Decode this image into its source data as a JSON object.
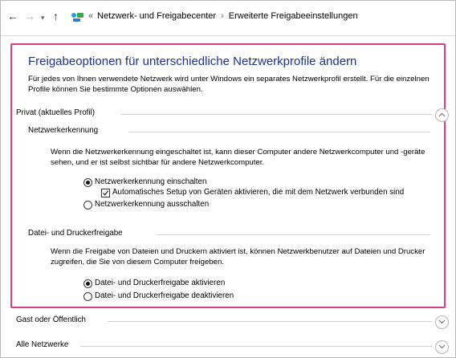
{
  "address_bar": {
    "back": "←",
    "forward": "→",
    "dropdown": "▾",
    "up": "↑",
    "overflow": "«",
    "crumbs": [
      "Netzwerk- und Freigabecenter",
      "Erweiterte Freigabeeinstellungen"
    ],
    "separator": "›"
  },
  "main": {
    "title": "Freigabeoptionen für unterschiedliche Netzwerkprofile ändern",
    "description": "Für jedes von Ihnen verwendete Netzwerk wird unter Windows ein separates Netzwerkprofil erstellt. Für die einzelnen Profile können Sie bestimmte Optionen auswählen."
  },
  "profiles": {
    "private": {
      "label": "Privat (aktuelles Profil)",
      "network_discovery": {
        "label": "Netzwerkerkennung",
        "text": "Wenn die Netzwerkerkennung eingeschaltet ist, kann dieser Computer andere Netzwerkcomputer und -geräte sehen, und er ist selbst sichtbar für andere Netzwerkcomputer.",
        "opt_on": "Netzwerkerkennung einschalten",
        "opt_auto": "Automatisches Setup von Geräten aktivieren, die mit dem Netzwerk verbunden sind",
        "opt_off": "Netzwerkerkennung ausschalten"
      },
      "file_printer": {
        "label": "Datei- und Druckerfreigabe",
        "text": "Wenn die Freigabe von Dateien und Druckern aktiviert ist, können Netzwerkbenutzer auf Dateien und Drucker zugreifen, die Sie von diesem Computer freigeben.",
        "opt_on": "Datei- und Druckerfreigabe aktivieren",
        "opt_off": "Datei- und Druckerfreigabe deaktivieren"
      }
    },
    "guest": {
      "label": "Gast oder Öffentlich"
    },
    "all": {
      "label": "Alle Netzwerke"
    }
  },
  "state": {
    "network_discovery": "on",
    "auto_setup": true,
    "file_printer": "on"
  },
  "colors": {
    "title": "#1e3287",
    "highlight_border": "#d93f86"
  },
  "icons": {
    "back": "arrow-left-icon",
    "forward": "arrow-right-icon",
    "up": "arrow-up-icon",
    "location": "control-panel-icon",
    "expand": "chevron-down-icon",
    "collapse": "chevron-up-icon"
  }
}
